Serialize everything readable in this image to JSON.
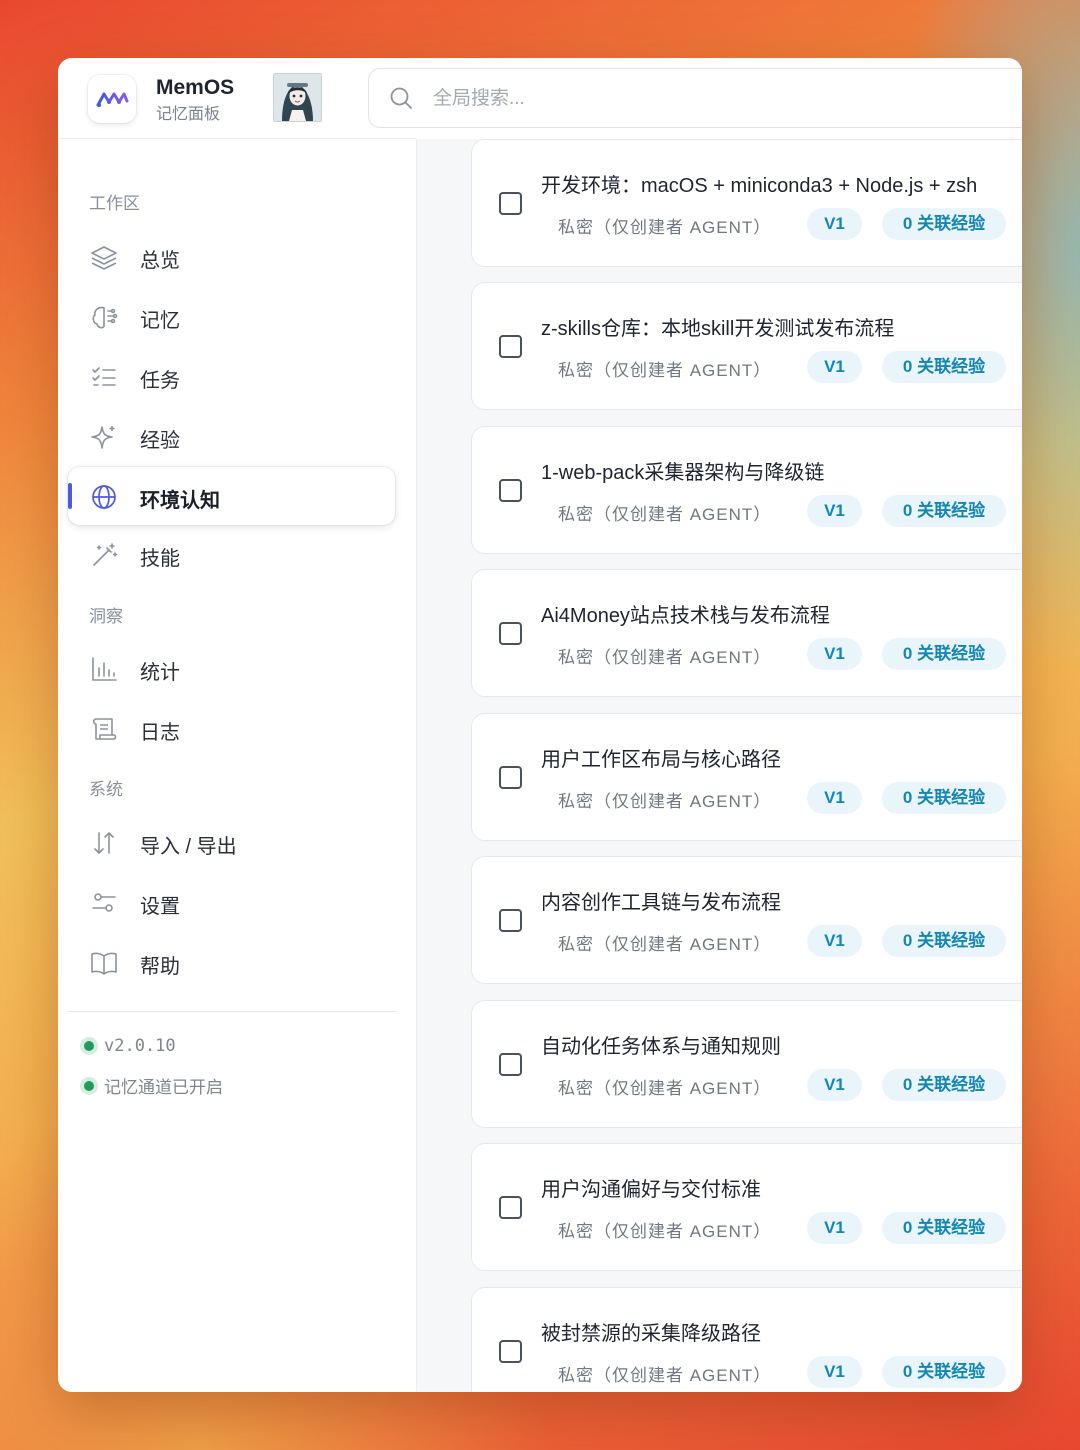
{
  "app": {
    "title": "MemOS",
    "subtitle": "记忆面板"
  },
  "search": {
    "placeholder": "全局搜索..."
  },
  "sidebar": {
    "sections": {
      "workspace": "工作区",
      "insights": "洞察",
      "system": "系统"
    },
    "items": [
      {
        "label": "总览",
        "icon": "layers-icon"
      },
      {
        "label": "记忆",
        "icon": "brain-icon"
      },
      {
        "label": "任务",
        "icon": "checklist-icon"
      },
      {
        "label": "经验",
        "icon": "sparkle-icon"
      },
      {
        "label": "环境认知",
        "icon": "globe-icon",
        "active": true
      },
      {
        "label": "技能",
        "icon": "magic-wand-icon"
      },
      {
        "label": "统计",
        "icon": "bar-chart-icon"
      },
      {
        "label": "日志",
        "icon": "scroll-icon"
      },
      {
        "label": "导入 / 导出",
        "icon": "transfer-icon"
      },
      {
        "label": "设置",
        "icon": "sliders-icon"
      },
      {
        "label": "帮助",
        "icon": "book-icon"
      }
    ],
    "version": "v2.0.10",
    "channel_status": "记忆通道已开启"
  },
  "cards": [
    {
      "title": "开发环境：macOS + miniconda3 + Node.js + zsh",
      "visibility": "私密（仅创建者 AGENT）",
      "version": "V1",
      "related": "0 关联经验"
    },
    {
      "title": "z-skills仓库：本地skill开发测试发布流程",
      "visibility": "私密（仅创建者 AGENT）",
      "version": "V1",
      "related": "0 关联经验"
    },
    {
      "title": "1-web-pack采集器架构与降级链",
      "visibility": "私密（仅创建者 AGENT）",
      "version": "V1",
      "related": "0 关联经验"
    },
    {
      "title": "Ai4Money站点技术栈与发布流程",
      "visibility": "私密（仅创建者 AGENT）",
      "version": "V1",
      "related": "0 关联经验"
    },
    {
      "title": "用户工作区布局与核心路径",
      "visibility": "私密（仅创建者 AGENT）",
      "version": "V1",
      "related": "0 关联经验"
    },
    {
      "title": "内容创作工具链与发布流程",
      "visibility": "私密（仅创建者 AGENT）",
      "version": "V1",
      "related": "0 关联经验"
    },
    {
      "title": "自动化任务体系与通知规则",
      "visibility": "私密（仅创建者 AGENT）",
      "version": "V1",
      "related": "0 关联经验"
    },
    {
      "title": "用户沟通偏好与交付标准",
      "visibility": "私密（仅创建者 AGENT）",
      "version": "V1",
      "related": "0 关联经验"
    },
    {
      "title": "被封禁源的采集降级路径",
      "visibility": "私密（仅创建者 AGENT）",
      "version": "V1",
      "related": "0 关联经验"
    }
  ],
  "colors": {
    "accent": "#4f5bdc",
    "badge_text": "#1486b3",
    "badge_bg": "#e9f5fb",
    "status_green": "#1f9b5a"
  }
}
